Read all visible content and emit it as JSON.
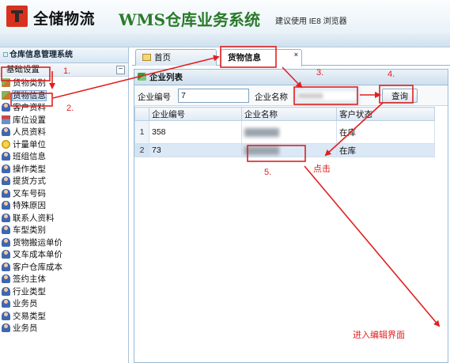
{
  "header": {
    "brand": "全储物流",
    "system_title": "WMS仓库业务系统",
    "browser_hint": "建议使用 IE8 浏览器"
  },
  "sidebar": {
    "title": "仓库信息管理系统",
    "group_label": "基础设置",
    "collapse_symbol": "−",
    "items": [
      {
        "label": "货物类别",
        "icon": "boxes-icon"
      },
      {
        "label": "货物信息",
        "icon": "boxes-icon",
        "selected": true
      },
      {
        "label": "客户资料",
        "icon": "user-icon"
      },
      {
        "label": "库位设置",
        "icon": "house-icon"
      },
      {
        "label": "人员资料",
        "icon": "user-icon"
      },
      {
        "label": "计量单位",
        "icon": "gauge-icon"
      },
      {
        "label": "班组信息",
        "icon": "user-icon"
      },
      {
        "label": "操作类型",
        "icon": "user-icon"
      },
      {
        "label": "提货方式",
        "icon": "user-icon"
      },
      {
        "label": "叉车号码",
        "icon": "user-icon"
      },
      {
        "label": "特殊原因",
        "icon": "user-icon"
      },
      {
        "label": "联系人资料",
        "icon": "user-icon"
      },
      {
        "label": "车型类别",
        "icon": "user-icon"
      },
      {
        "label": "货物搬运单价",
        "icon": "user-icon"
      },
      {
        "label": "叉车成本单价",
        "icon": "user-icon"
      },
      {
        "label": "客户仓库成本",
        "icon": "user-icon"
      },
      {
        "label": "签约主体",
        "icon": "user-icon"
      },
      {
        "label": "行业类型",
        "icon": "user-icon"
      },
      {
        "label": "业务员",
        "icon": "user-icon"
      },
      {
        "label": "交易类型",
        "icon": "user-icon"
      },
      {
        "label": "业务员",
        "icon": "user-icon"
      }
    ]
  },
  "tabs": [
    {
      "label": "首页",
      "active": false
    },
    {
      "label": "货物信息",
      "active": true,
      "close": "×"
    }
  ],
  "panel": {
    "title": "企业列表",
    "search": {
      "code_label": "企业编号",
      "code_value": "7",
      "name_label": "企业名称",
      "name_value": "xxxxxx",
      "query_button": "查询"
    },
    "table": {
      "columns": [
        "企业编号",
        "企业名称",
        "客户状态"
      ],
      "rows": [
        {
          "num": "1",
          "code": "358",
          "status": "在库"
        },
        {
          "num": "2",
          "code": "73",
          "status": "在库"
        }
      ]
    }
  },
  "annotations": {
    "step1": "1.",
    "step2": "2.",
    "step3": "3.",
    "step4": "4.",
    "step5": "5.",
    "click": "点击",
    "enter_edit": "进入编辑界面"
  }
}
